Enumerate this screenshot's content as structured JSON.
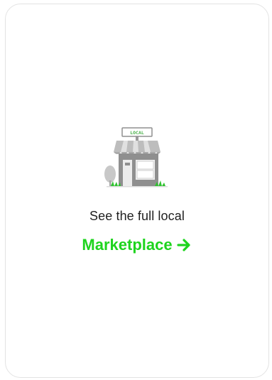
{
  "card": {
    "illustration_icon": "local-storefront-icon",
    "sign_text": "LOCAL",
    "caption": "See the full local",
    "link_label": "Marketplace",
    "link_icon": "arrow-right-icon"
  },
  "colors": {
    "accent": "#1ed41e",
    "text": "#1f1f1f",
    "card_border": "#e3e3e3",
    "store_gray": "#8f8f8f",
    "grass": "#31c231"
  }
}
